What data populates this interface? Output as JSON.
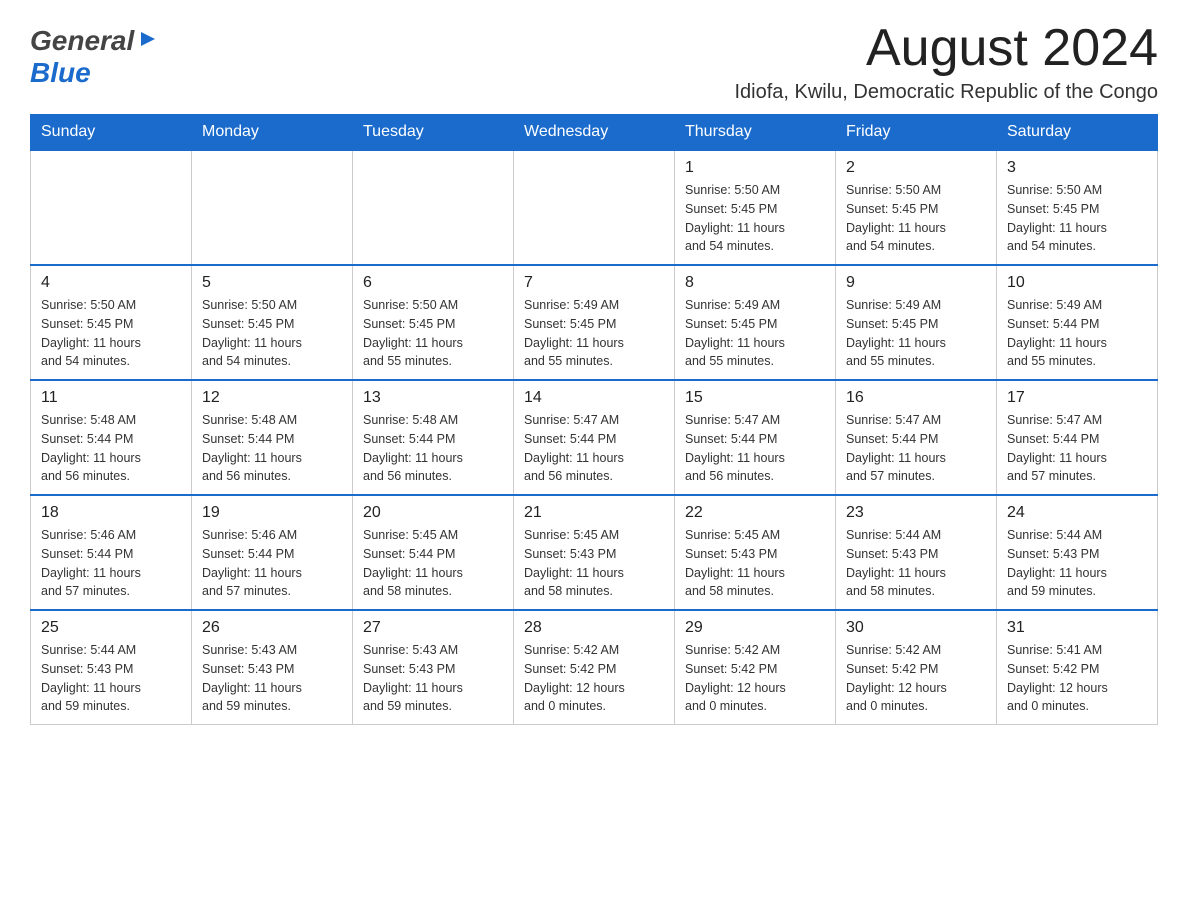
{
  "header": {
    "logo_general": "General",
    "logo_blue": "Blue",
    "month_title": "August 2024",
    "location": "Idiofa, Kwilu, Democratic Republic of the Congo"
  },
  "calendar": {
    "days_of_week": [
      "Sunday",
      "Monday",
      "Tuesday",
      "Wednesday",
      "Thursday",
      "Friday",
      "Saturday"
    ],
    "weeks": [
      {
        "days": [
          {
            "number": "",
            "info": ""
          },
          {
            "number": "",
            "info": ""
          },
          {
            "number": "",
            "info": ""
          },
          {
            "number": "",
            "info": ""
          },
          {
            "number": "1",
            "info": "Sunrise: 5:50 AM\nSunset: 5:45 PM\nDaylight: 11 hours\nand 54 minutes."
          },
          {
            "number": "2",
            "info": "Sunrise: 5:50 AM\nSunset: 5:45 PM\nDaylight: 11 hours\nand 54 minutes."
          },
          {
            "number": "3",
            "info": "Sunrise: 5:50 AM\nSunset: 5:45 PM\nDaylight: 11 hours\nand 54 minutes."
          }
        ]
      },
      {
        "days": [
          {
            "number": "4",
            "info": "Sunrise: 5:50 AM\nSunset: 5:45 PM\nDaylight: 11 hours\nand 54 minutes."
          },
          {
            "number": "5",
            "info": "Sunrise: 5:50 AM\nSunset: 5:45 PM\nDaylight: 11 hours\nand 54 minutes."
          },
          {
            "number": "6",
            "info": "Sunrise: 5:50 AM\nSunset: 5:45 PM\nDaylight: 11 hours\nand 55 minutes."
          },
          {
            "number": "7",
            "info": "Sunrise: 5:49 AM\nSunset: 5:45 PM\nDaylight: 11 hours\nand 55 minutes."
          },
          {
            "number": "8",
            "info": "Sunrise: 5:49 AM\nSunset: 5:45 PM\nDaylight: 11 hours\nand 55 minutes."
          },
          {
            "number": "9",
            "info": "Sunrise: 5:49 AM\nSunset: 5:45 PM\nDaylight: 11 hours\nand 55 minutes."
          },
          {
            "number": "10",
            "info": "Sunrise: 5:49 AM\nSunset: 5:44 PM\nDaylight: 11 hours\nand 55 minutes."
          }
        ]
      },
      {
        "days": [
          {
            "number": "11",
            "info": "Sunrise: 5:48 AM\nSunset: 5:44 PM\nDaylight: 11 hours\nand 56 minutes."
          },
          {
            "number": "12",
            "info": "Sunrise: 5:48 AM\nSunset: 5:44 PM\nDaylight: 11 hours\nand 56 minutes."
          },
          {
            "number": "13",
            "info": "Sunrise: 5:48 AM\nSunset: 5:44 PM\nDaylight: 11 hours\nand 56 minutes."
          },
          {
            "number": "14",
            "info": "Sunrise: 5:47 AM\nSunset: 5:44 PM\nDaylight: 11 hours\nand 56 minutes."
          },
          {
            "number": "15",
            "info": "Sunrise: 5:47 AM\nSunset: 5:44 PM\nDaylight: 11 hours\nand 56 minutes."
          },
          {
            "number": "16",
            "info": "Sunrise: 5:47 AM\nSunset: 5:44 PM\nDaylight: 11 hours\nand 57 minutes."
          },
          {
            "number": "17",
            "info": "Sunrise: 5:47 AM\nSunset: 5:44 PM\nDaylight: 11 hours\nand 57 minutes."
          }
        ]
      },
      {
        "days": [
          {
            "number": "18",
            "info": "Sunrise: 5:46 AM\nSunset: 5:44 PM\nDaylight: 11 hours\nand 57 minutes."
          },
          {
            "number": "19",
            "info": "Sunrise: 5:46 AM\nSunset: 5:44 PM\nDaylight: 11 hours\nand 57 minutes."
          },
          {
            "number": "20",
            "info": "Sunrise: 5:45 AM\nSunset: 5:44 PM\nDaylight: 11 hours\nand 58 minutes."
          },
          {
            "number": "21",
            "info": "Sunrise: 5:45 AM\nSunset: 5:43 PM\nDaylight: 11 hours\nand 58 minutes."
          },
          {
            "number": "22",
            "info": "Sunrise: 5:45 AM\nSunset: 5:43 PM\nDaylight: 11 hours\nand 58 minutes."
          },
          {
            "number": "23",
            "info": "Sunrise: 5:44 AM\nSunset: 5:43 PM\nDaylight: 11 hours\nand 58 minutes."
          },
          {
            "number": "24",
            "info": "Sunrise: 5:44 AM\nSunset: 5:43 PM\nDaylight: 11 hours\nand 59 minutes."
          }
        ]
      },
      {
        "days": [
          {
            "number": "25",
            "info": "Sunrise: 5:44 AM\nSunset: 5:43 PM\nDaylight: 11 hours\nand 59 minutes."
          },
          {
            "number": "26",
            "info": "Sunrise: 5:43 AM\nSunset: 5:43 PM\nDaylight: 11 hours\nand 59 minutes."
          },
          {
            "number": "27",
            "info": "Sunrise: 5:43 AM\nSunset: 5:43 PM\nDaylight: 11 hours\nand 59 minutes."
          },
          {
            "number": "28",
            "info": "Sunrise: 5:42 AM\nSunset: 5:42 PM\nDaylight: 12 hours\nand 0 minutes."
          },
          {
            "number": "29",
            "info": "Sunrise: 5:42 AM\nSunset: 5:42 PM\nDaylight: 12 hours\nand 0 minutes."
          },
          {
            "number": "30",
            "info": "Sunrise: 5:42 AM\nSunset: 5:42 PM\nDaylight: 12 hours\nand 0 minutes."
          },
          {
            "number": "31",
            "info": "Sunrise: 5:41 AM\nSunset: 5:42 PM\nDaylight: 12 hours\nand 0 minutes."
          }
        ]
      }
    ]
  }
}
